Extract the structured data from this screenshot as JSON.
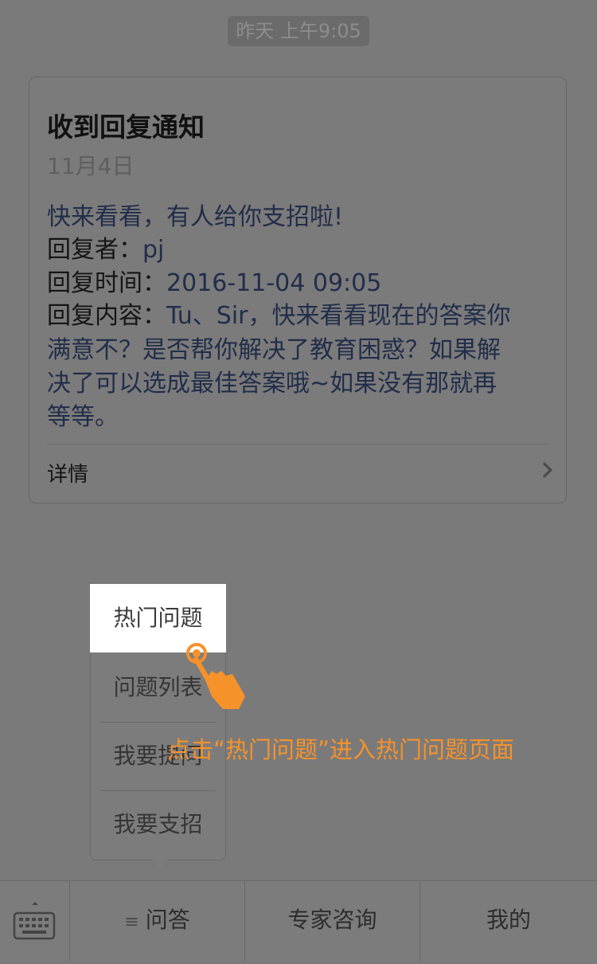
{
  "timestamp": "昨天 上午9:05",
  "card": {
    "title": "收到回复通知",
    "date": "11月4日",
    "intro": "快来看看，有人给你支招啦!",
    "replier_label": "回复者：",
    "replier_value": "pj",
    "time_label": "回复时间：",
    "time_value": "2016-11-04 09:05",
    "content_label": "回复内容：",
    "content_line1": "Tu、Sir，快来看看现在的答案你",
    "content_line2": "满意不？是否帮你解决了教育困惑？如果解",
    "content_line3": "决了可以选成最佳答案哦~如果没有那就再",
    "content_line4": "等等。",
    "detail_label": "详情"
  },
  "popup_menu": {
    "items": [
      {
        "label": "热门问题",
        "active": true
      },
      {
        "label": "问题列表"
      },
      {
        "label": "我要提问"
      },
      {
        "label": "我要支招"
      }
    ]
  },
  "tabbar": {
    "tabs": [
      {
        "label": "问答",
        "icon": "menu-icon"
      },
      {
        "label": "专家咨询"
      },
      {
        "label": "我的"
      }
    ]
  },
  "instruction": "点击“热门问题”进入热门问题页面",
  "colors": {
    "overlay": "#7a7a7a",
    "accent": "#f6922a",
    "link_text": "#222d4a"
  }
}
